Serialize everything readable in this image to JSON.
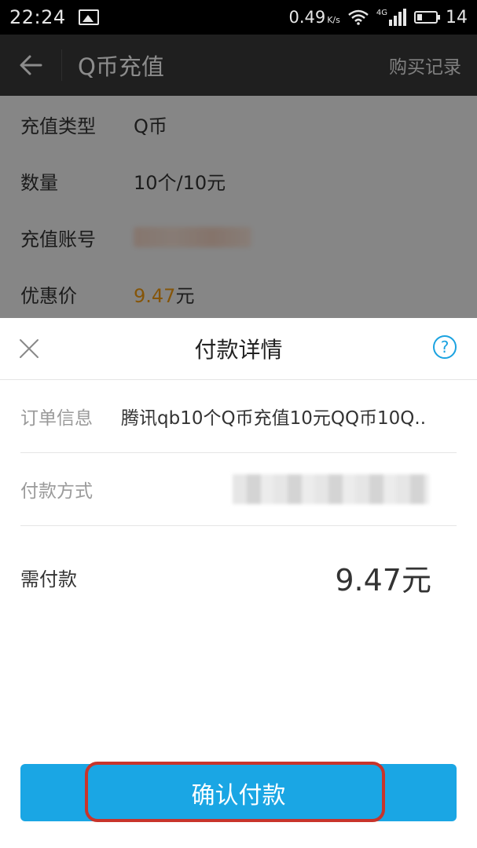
{
  "status_bar": {
    "time": "22:24",
    "net_speed": "0.49",
    "net_speed_unit": "K/s",
    "network_type": "4G",
    "battery_level": "14"
  },
  "header": {
    "title": "Q币充值",
    "purchase_record": "购买记录"
  },
  "info": {
    "type_label": "充值类型",
    "type_value": "Q币",
    "quantity_label": "数量",
    "quantity_value": "10个/10元",
    "account_label": "充值账号",
    "discount_label": "优惠价",
    "discount_value": "9.47",
    "discount_unit": "元"
  },
  "sheet": {
    "title": "付款详情",
    "order_label": "订单信息",
    "order_value": "腾讯qb10个Q币充值10元QQ币10Q..",
    "payment_label": "付款方式",
    "amount_label": "需付款",
    "amount_value": "9.47元",
    "confirm_label": "确认付款"
  },
  "colors": {
    "accent": "#1aa6e4",
    "price": "#f39c12",
    "highlight": "#c8342b"
  }
}
